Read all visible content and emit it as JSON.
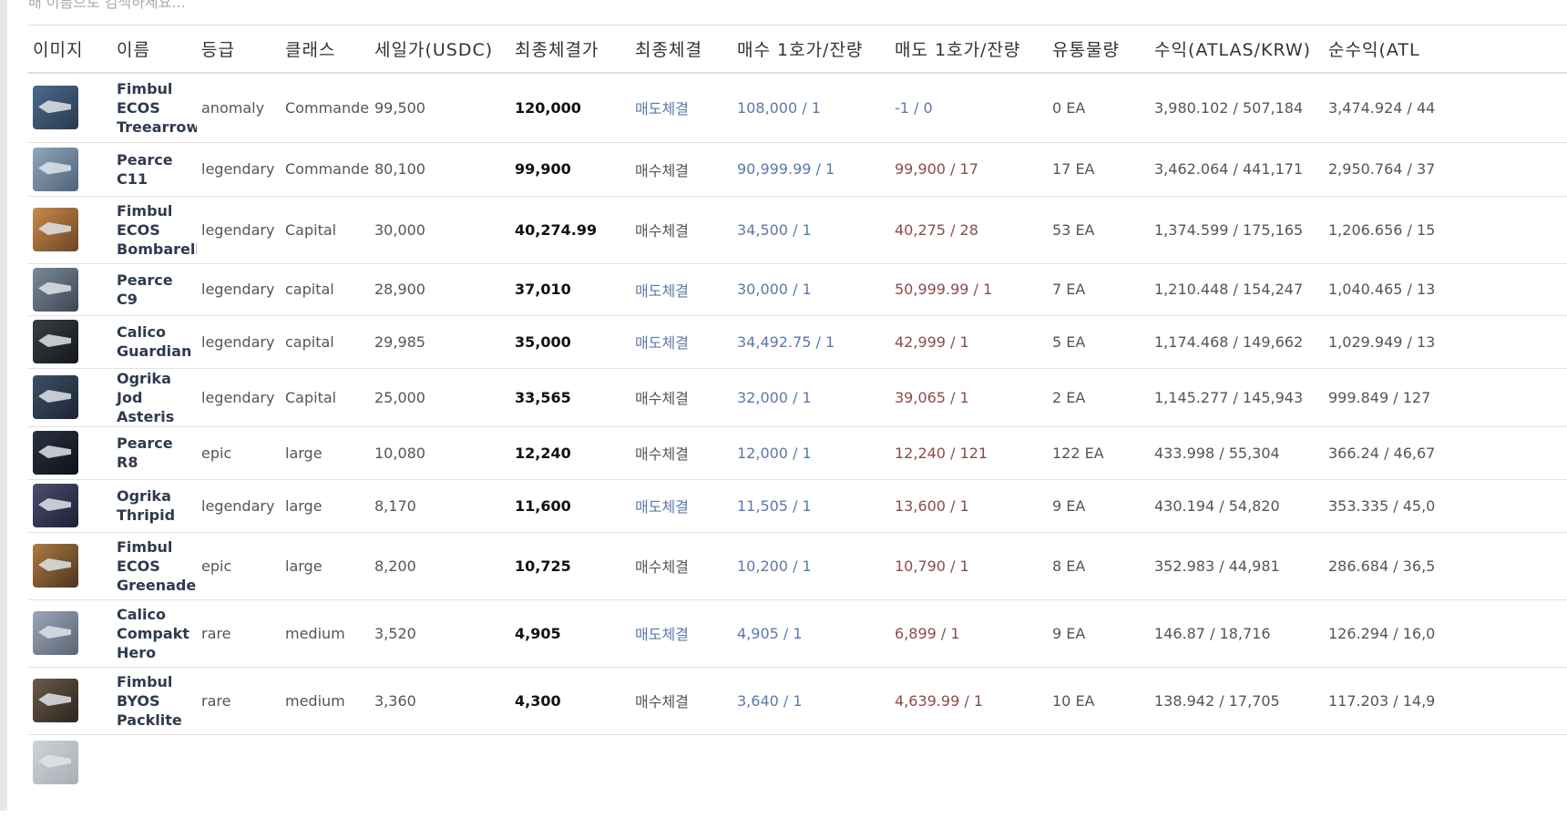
{
  "search": {
    "placeholder": "배 이름으로 검색하세요..."
  },
  "columns": [
    "이미지",
    "이름",
    "등급",
    "클래스",
    "세일가(USDC)",
    "최종체결가",
    "최종체결",
    "매수 1호가/잔량",
    "매도 1호가/잔량",
    "유통물량",
    "수익(ATLAS/KRW)",
    "순수익(ATL"
  ],
  "colors": {
    "accent_blue": "#5b79a8",
    "sell_red": "#8a4c4c",
    "name_dark": "#2e3a4e"
  },
  "rows": [
    {
      "name": "Fimbul ECOS Treearrow",
      "grade": "anomaly",
      "class": "Commander",
      "sale": "99,500",
      "last": "120,000",
      "trade": "매도체결",
      "bid_price": "108,000",
      "bid_qty": " / 1",
      "ask_price": "-1",
      "ask_qty": " / 0",
      "supply": "0 EA",
      "profit": "3,980.102 / 507,184",
      "net": "3,474.924 / 44",
      "thumb": [
        "#4a6a8c",
        "#2a3b4e"
      ]
    },
    {
      "name": "Pearce C11",
      "grade": "legendary",
      "class": "Commander",
      "sale": "80,100",
      "last": "99,900",
      "trade": "매수체결",
      "bid_price": "90,999.99",
      "bid_qty": " / 1",
      "ask_price": "99,900",
      "ask_qty": " / 17",
      "supply": "17 EA",
      "profit": "3,462.064 / 441,171",
      "net": "2,950.764 / 37",
      "thumb": [
        "#8fa6bd",
        "#4f6379"
      ]
    },
    {
      "name": "Fimbul ECOS Bombarella",
      "grade": "legendary",
      "class": "Capital",
      "sale": "30,000",
      "last": "40,274.99",
      "trade": "매수체결",
      "bid_price": "34,500",
      "bid_qty": " / 1",
      "ask_price": "40,275",
      "ask_qty": " / 28",
      "supply": "53 EA",
      "profit": "1,374.599 / 175,165",
      "net": "1,206.656 / 15",
      "thumb": [
        "#c98a4a",
        "#6b4426"
      ]
    },
    {
      "name": "Pearce C9",
      "grade": "legendary",
      "class": "capital",
      "sale": "28,900",
      "last": "37,010",
      "trade": "매도체결",
      "bid_price": "30,000",
      "bid_qty": " / 1",
      "ask_price": "50,999.99",
      "ask_qty": " / 1",
      "supply": "7 EA",
      "profit": "1,210.448 / 154,247",
      "net": "1,040.465 / 13",
      "thumb": [
        "#7a8a9a",
        "#3c4652"
      ]
    },
    {
      "name": "Calico Guardian",
      "grade": "legendary",
      "class": "capital",
      "sale": "29,985",
      "last": "35,000",
      "trade": "매도체결",
      "bid_price": "34,492.75",
      "bid_qty": " / 1",
      "ask_price": "42,999",
      "ask_qty": " / 1",
      "supply": "5 EA",
      "profit": "1,174.468 / 149,662",
      "net": "1,029.949 / 13",
      "thumb": [
        "#3a3f46",
        "#14171b"
      ]
    },
    {
      "name": "Ogrika Jod Asteris",
      "grade": "legendary",
      "class": "Capital",
      "sale": "25,000",
      "last": "33,565",
      "trade": "매수체결",
      "bid_price": "32,000",
      "bid_qty": " / 1",
      "ask_price": "39,065",
      "ask_qty": " / 1",
      "supply": "2 EA",
      "profit": "1,145.277 / 145,943",
      "net": "999.849 / 127",
      "thumb": [
        "#3d5068",
        "#1b2533"
      ]
    },
    {
      "name": "Pearce R8",
      "grade": "epic",
      "class": "large",
      "sale": "10,080",
      "last": "12,240",
      "trade": "매수체결",
      "bid_price": "12,000",
      "bid_qty": " / 1",
      "ask_price": "12,240",
      "ask_qty": " / 121",
      "supply": "122 EA",
      "profit": "433.998 / 55,304",
      "net": "366.24 / 46,67",
      "thumb": [
        "#2a3140",
        "#0e1218"
      ]
    },
    {
      "name": "Ogrika Thripid",
      "grade": "legendary",
      "class": "large",
      "sale": "8,170",
      "last": "11,600",
      "trade": "매도체결",
      "bid_price": "11,505",
      "bid_qty": " / 1",
      "ask_price": "13,600",
      "ask_qty": " / 1",
      "supply": "9 EA",
      "profit": "430.194 / 54,820",
      "net": "353.335 / 45,0",
      "thumb": [
        "#4b4f70",
        "#1d1f33"
      ]
    },
    {
      "name": "Fimbul ECOS Greenader",
      "grade": "epic",
      "class": "large",
      "sale": "8,200",
      "last": "10,725",
      "trade": "매수체결",
      "bid_price": "10,200",
      "bid_qty": " / 1",
      "ask_price": "10,790",
      "ask_qty": " / 1",
      "supply": "8 EA",
      "profit": "352.983 / 44,981",
      "net": "286.684 / 36,5",
      "thumb": [
        "#b07a3e",
        "#4a3520"
      ]
    },
    {
      "name": "Calico Compakt Hero",
      "grade": "rare",
      "class": "medium",
      "sale": "3,520",
      "last": "4,905",
      "trade": "매도체결",
      "bid_price": "4,905",
      "bid_qty": " / 1",
      "ask_price": "6,899",
      "ask_qty": " / 1",
      "supply": "9 EA",
      "profit": "146.87 / 18,716",
      "net": "126.294 / 16,0",
      "thumb": [
        "#9aa7b6",
        "#5a6676"
      ]
    },
    {
      "name": "Fimbul BYOS Packlite",
      "grade": "rare",
      "class": "medium",
      "sale": "3,360",
      "last": "4,300",
      "trade": "매수체결",
      "bid_price": "3,640",
      "bid_qty": " / 1",
      "ask_price": "4,639.99",
      "ask_qty": " / 1",
      "supply": "10 EA",
      "profit": "138.942 / 17,705",
      "net": "117.203 / 14,9",
      "thumb": [
        "#6d5a4a",
        "#2c241d"
      ]
    },
    {
      "name": "",
      "grade": "",
      "class": "",
      "sale": "",
      "last": "",
      "trade": "",
      "bid_price": "",
      "bid_qty": "",
      "ask_price": "",
      "ask_qty": "",
      "supply": "",
      "profit": "",
      "net": "",
      "thumb": [
        "#cfd3d8",
        "#a9aeb5"
      ]
    }
  ]
}
